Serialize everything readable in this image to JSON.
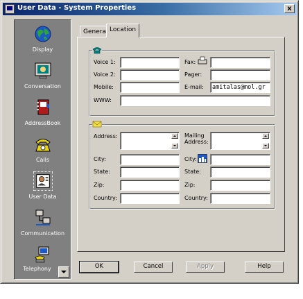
{
  "window": {
    "title": "User Data - System Properties",
    "close_glyph": "x"
  },
  "sidebar": {
    "items": [
      {
        "id": "display",
        "label": "Display",
        "icon": "globe-icon"
      },
      {
        "id": "conversation",
        "label": "Conversation",
        "icon": "monitor-icon"
      },
      {
        "id": "addressbook",
        "label": "AddressBook",
        "icon": "addressbook-icon"
      },
      {
        "id": "calls",
        "label": "Calls",
        "icon": "telephone-icon"
      },
      {
        "id": "userdata",
        "label": "User Data",
        "icon": "user-card-icon"
      },
      {
        "id": "communication",
        "label": "Communication",
        "icon": "network-icon"
      },
      {
        "id": "telephony",
        "label": "Telephony",
        "icon": "telephony-icon"
      }
    ]
  },
  "tabs": [
    {
      "label": "General"
    },
    {
      "label": "Location"
    }
  ],
  "contact": {
    "voice1_label": "Voice 1:",
    "voice1": "",
    "voice2_label": "Voice 2:",
    "voice2": "",
    "mobile_label": "Mobile:",
    "mobile": "",
    "www_label": "WWW:",
    "www": "",
    "fax_label": "Fax:",
    "fax": "",
    "pager_label": "Pager:",
    "pager": "",
    "email_label": "E-mail:",
    "email": "amitalas@mol.gr"
  },
  "address": {
    "address_label": "Address:",
    "address": "",
    "mailing_label_1": "Mailing",
    "mailing_label_2": "Address:",
    "mailing": "",
    "city_label": "City:",
    "city": "",
    "state_label": "State:",
    "state": "",
    "zip_label": "Zip:",
    "zip": "",
    "country_label": "Country:",
    "country": "",
    "m_city_label": "City:",
    "m_city": "",
    "m_state_label": "State:",
    "m_state": "",
    "m_zip_label": "Zip:",
    "m_zip": "",
    "m_country_label": "Country:",
    "m_country": ""
  },
  "buttons": {
    "ok": "OK",
    "cancel": "Cancel",
    "apply": "Apply",
    "help": "Help"
  }
}
